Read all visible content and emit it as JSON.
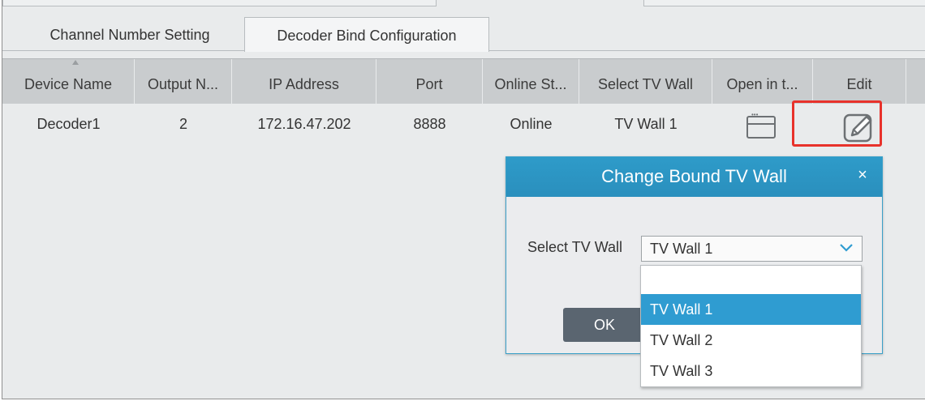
{
  "tabs": {
    "channel_number_setting": "Channel Number Setting",
    "decoder_bind_configuration": "Decoder Bind Configuration"
  },
  "table": {
    "columns": [
      "Device Name",
      "Output N...",
      "IP Address",
      "Port",
      "Online St...",
      "Select TV Wall",
      "Open in t...",
      "Edit"
    ],
    "rows": [
      {
        "device_name": "Decoder1",
        "output_number": "2",
        "ip_address": "172.16.47.202",
        "port": "8888",
        "online_status": "Online",
        "tv_wall": "TV Wall 1",
        "open_icon": "window-icon",
        "edit_icon": "edit-pencil-icon"
      }
    ]
  },
  "dialog": {
    "title": "Change Bound TV Wall",
    "close": "×",
    "select_label": "Select TV Wall",
    "selected_value": "TV Wall 1",
    "ok_label": "OK",
    "options": [
      "",
      "TV Wall 1",
      "TV Wall 2",
      "TV Wall 3"
    ]
  },
  "colors": {
    "accent": "#2f9cd1",
    "highlight": "#e8322b",
    "header": "#c9ccce",
    "ok_button": "#5a6570"
  }
}
